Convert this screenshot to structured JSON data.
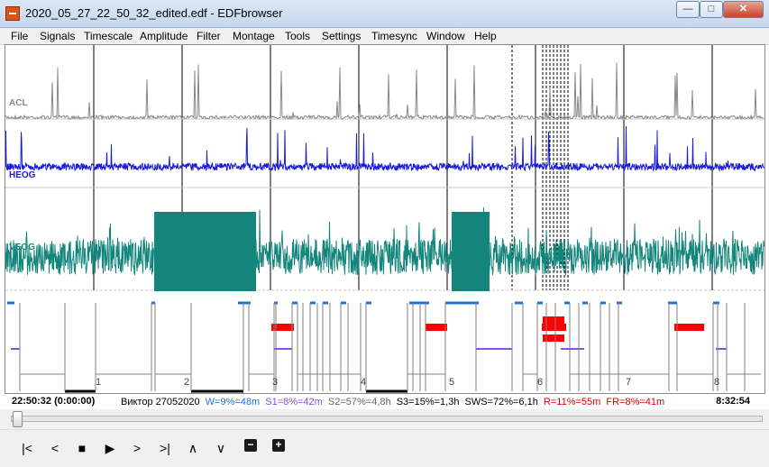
{
  "window": {
    "title": "2020_05_27_22_50_32_edited.edf - EDFbrowser",
    "minimize_glyph": "—",
    "maximize_glyph": "□",
    "close_glyph": "✕"
  },
  "menu": [
    "File",
    "Signals",
    "Timescale",
    "Amplitude",
    "Filter",
    "Montage",
    "Tools",
    "Settings",
    "Timesync",
    "Window",
    "Help"
  ],
  "signals": [
    {
      "label": "ACL",
      "color": "#888888"
    },
    {
      "label": "HEOG",
      "color": "#1a1adc"
    },
    {
      "label": "VEOG",
      "color": "#13857b"
    }
  ],
  "hypnogram": {
    "hour_labels": [
      "1",
      "2",
      "3",
      "4",
      "5",
      "6",
      "7",
      "8"
    ],
    "colors": {
      "wake": "#1e73d6",
      "s1": "#8a4fe0",
      "rem": "#ff0000",
      "sws": "#000000",
      "grid": "#808080"
    }
  },
  "status": {
    "start_time": "22:50:32 (0:00:00)",
    "end_time": "8:32:54",
    "stats": [
      {
        "text": "Виктор 27052020",
        "color": "#000000"
      },
      {
        "text": "W=9%=48m",
        "color": "#1e73d6"
      },
      {
        "text": "S1=8%=42m",
        "color": "#8a4fe0"
      },
      {
        "text": "S2=57%=4,8h",
        "color": "#666666"
      },
      {
        "text": "S3=15%=1,3h",
        "color": "#000000"
      },
      {
        "text": "SWS=72%=6,1h",
        "color": "#000000"
      },
      {
        "text": "R=11%=55m",
        "color": "#e00000"
      },
      {
        "text": "FR=8%=41m",
        "color": "#e00000"
      }
    ]
  },
  "toolbar": {
    "buttons": [
      {
        "name": "first-page-button",
        "glyph": "|<"
      },
      {
        "name": "prev-page-button",
        "glyph": "<"
      },
      {
        "name": "stop-button",
        "glyph": "■"
      },
      {
        "name": "play-button",
        "glyph": "▶"
      },
      {
        "name": "next-page-button",
        "glyph": ">"
      },
      {
        "name": "last-page-button",
        "glyph": ">|"
      },
      {
        "name": "amplitude-up-button",
        "glyph": "∧"
      },
      {
        "name": "amplitude-down-button",
        "glyph": "∨"
      },
      {
        "name": "zoom-out-button",
        "glyph": "−"
      },
      {
        "name": "zoom-in-button",
        "glyph": "+"
      }
    ]
  }
}
